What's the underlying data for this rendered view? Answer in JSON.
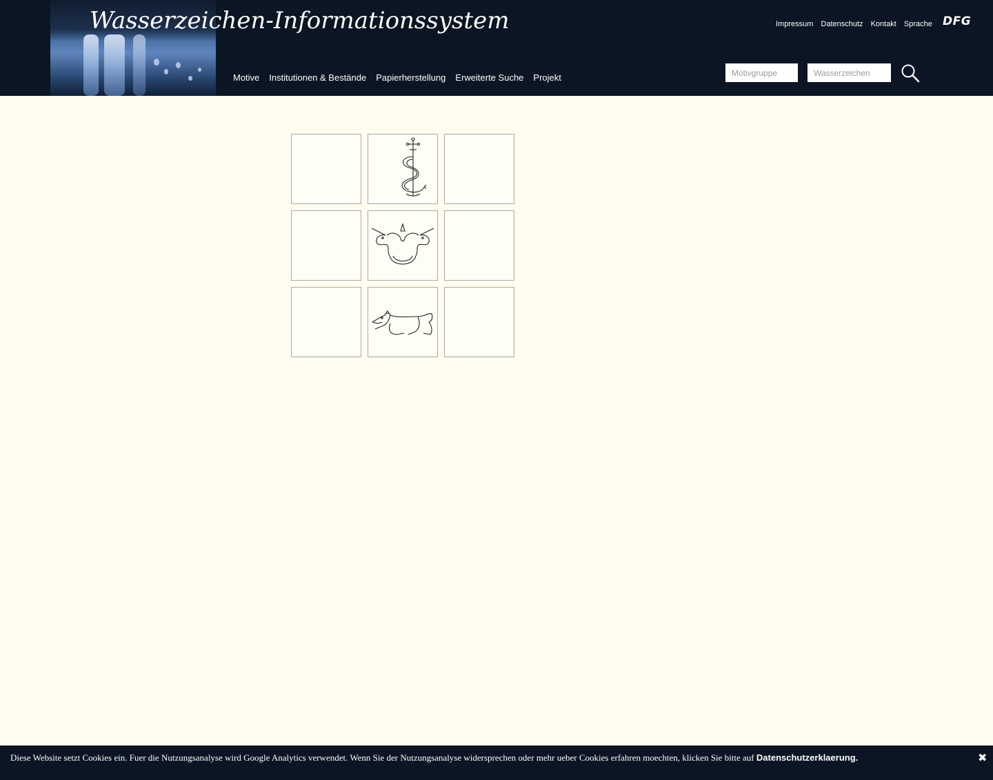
{
  "header": {
    "title": "Wasserzeichen-Informationssystem",
    "nav": [
      "Motive",
      "Institutionen & Bestände",
      "Papierherstellung",
      "Erweiterte Suche",
      "Projekt"
    ],
    "top_links": [
      "Impressum",
      "Datenschutz",
      "Kontakt",
      "Sprache"
    ],
    "dfg_logo": "DFG",
    "search": {
      "motivgruppe_placeholder": "Motivgruppe",
      "wasserzeichen_placeholder": "Wasserzeichen",
      "button_icon": "magnifier-icon"
    }
  },
  "watermark_grid": {
    "tiles": [
      {
        "icon": "empty"
      },
      {
        "icon": "snake-cross-icon"
      },
      {
        "icon": "empty"
      },
      {
        "icon": "empty"
      },
      {
        "icon": "two-unicorns-icon"
      },
      {
        "icon": "empty"
      },
      {
        "icon": "empty"
      },
      {
        "icon": "greyhound-icon"
      },
      {
        "icon": "empty"
      }
    ]
  },
  "cookie_banner": {
    "text": "Diese Website setzt Cookies ein. Fuer die Nutzungsanalyse wird Google Analytics verwendet. Wenn Sie der Nutzungsanalyse widersprechen oder mehr ueber Cookies erfahren moechten, klicken Sie bitte auf ",
    "link_label": "Datenschutzerklaerung.",
    "close_label": "✖"
  },
  "colors": {
    "header_bg": "#0b1523",
    "page_bg": "#fefdef",
    "tile_border": "#a8a8a8"
  }
}
